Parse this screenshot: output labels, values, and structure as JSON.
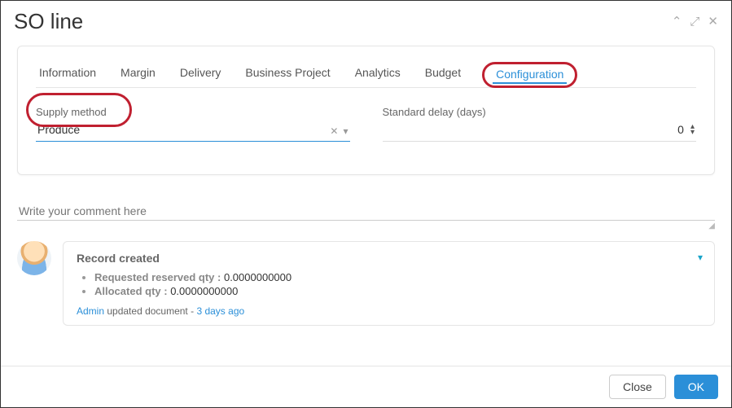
{
  "header": {
    "title": "SO line"
  },
  "tabs": {
    "items": [
      {
        "label": "Information"
      },
      {
        "label": "Margin"
      },
      {
        "label": "Delivery"
      },
      {
        "label": "Business Project"
      },
      {
        "label": "Analytics"
      },
      {
        "label": "Budget"
      },
      {
        "label": "Configuration"
      }
    ],
    "active_index": 6
  },
  "form": {
    "supply_method": {
      "label": "Supply method",
      "value": "Produce"
    },
    "standard_delay": {
      "label": "Standard delay (days)",
      "value": "0"
    }
  },
  "comments": {
    "placeholder": "Write your comment here"
  },
  "record": {
    "title": "Record created",
    "items": [
      {
        "label": "Requested reserved qty :",
        "value": "0.0000000000"
      },
      {
        "label": "Allocated qty :",
        "value": "0.0000000000"
      }
    ],
    "meta": {
      "user": "Admin",
      "action": "updated document",
      "sep": " - ",
      "time": "3 days ago"
    }
  },
  "footer": {
    "close_label": "Close",
    "ok_label": "OK"
  }
}
